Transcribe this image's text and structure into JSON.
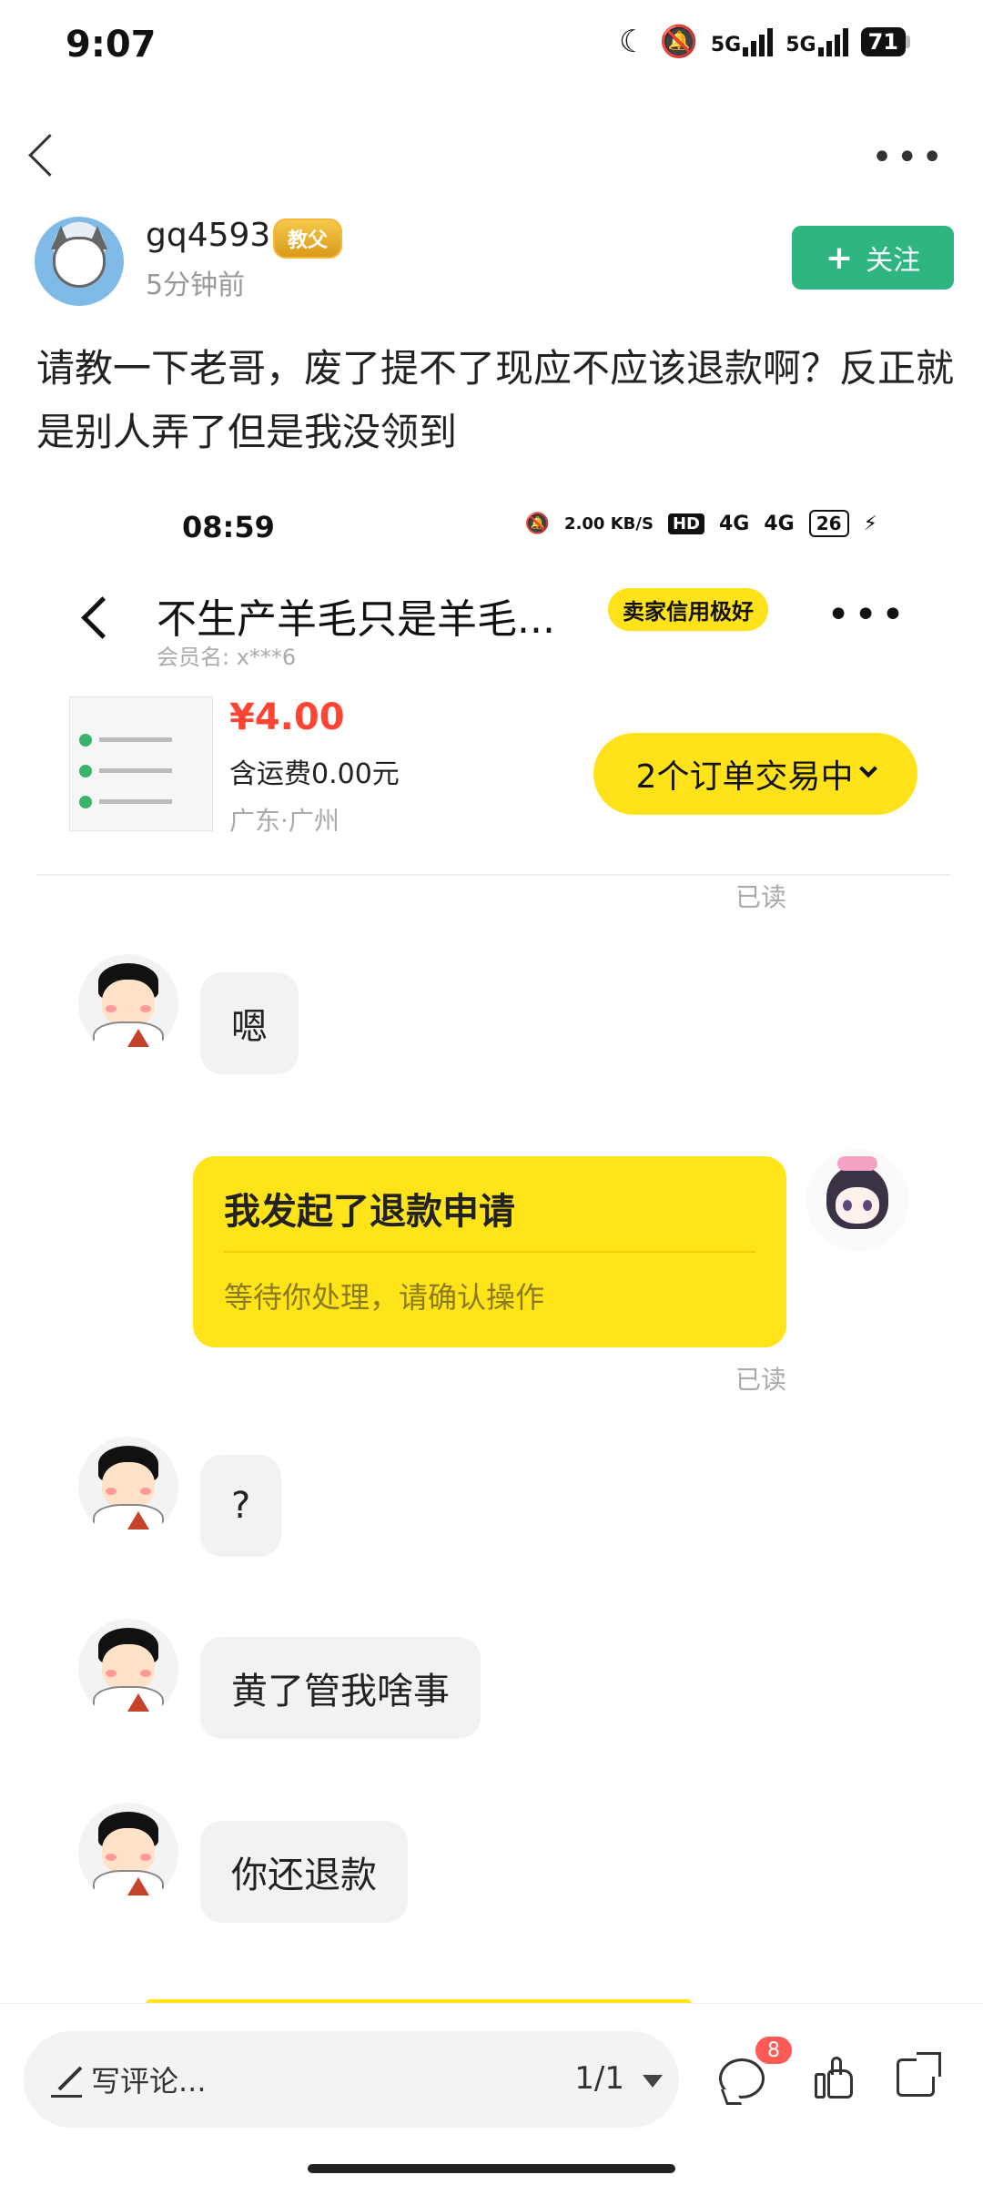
{
  "status_bar": {
    "time": "9:07",
    "network1": "5G",
    "network2": "5G",
    "battery": "71"
  },
  "post": {
    "username": "gq4593",
    "badge": "教父",
    "time_ago": "5分钟前",
    "follow_label": "关注",
    "text": "请教一下老哥，废了提不了现应不应该退款啊？反正就是别人弄了但是我没领到"
  },
  "screenshot": {
    "status": {
      "time": "08:59",
      "speed": "2.00 KB/S",
      "hd": "HD",
      "net1": "4G",
      "net2": "4G",
      "battery": "26"
    },
    "header": {
      "title": "不生产羊毛只是羊毛...",
      "seller_badge": "卖家信用极好",
      "member": "会员名:  x***6"
    },
    "order": {
      "price": "¥4.00",
      "shipping": "含运费0.00元",
      "location": "广东·广州",
      "trade_button": "2个订单交易中"
    },
    "read_label": "已读",
    "messages": [
      {
        "side": "left",
        "text": "嗯"
      },
      {
        "side": "right",
        "title": "我发起了退款申请",
        "subtitle": "等待你处理，请确认操作"
      },
      {
        "side": "left",
        "text": "?"
      },
      {
        "side": "left",
        "text": "黄了管我啥事"
      },
      {
        "side": "left",
        "text": "你还退款"
      }
    ]
  },
  "bottom_bar": {
    "comment_placeholder": "写评论...",
    "pager": "1/1",
    "comment_count": "8"
  },
  "colors": {
    "follow_green": "#2fb57f",
    "xianyu_yellow": "#ffe41a",
    "price_red": "#ff4433",
    "badge_red": "#ff5a55"
  }
}
